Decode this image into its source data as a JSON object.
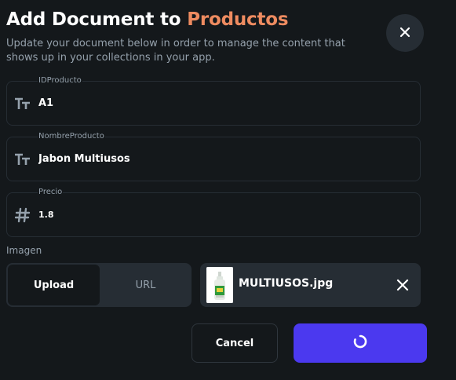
{
  "dialog": {
    "title_prefix": "Add Document to ",
    "title_collection": "Productos",
    "subtitle": "Update your document below in order to manage the content that shows up in your collections in your app.",
    "close_icon": "close-icon"
  },
  "fields": [
    {
      "label": "IDProducto",
      "value": "A1",
      "icon": "text-type-icon"
    },
    {
      "label": "NombreProducto",
      "value": "Jabon Multiusos",
      "icon": "text-type-icon"
    },
    {
      "label": "Precio",
      "value": "1.8",
      "icon": "number-hash-icon"
    }
  ],
  "image_section": {
    "label": "Imagen",
    "toggle": {
      "upload_label": "Upload",
      "url_label": "URL",
      "selected": "Upload"
    },
    "file": {
      "name": "MULTIUSOS.jpg",
      "remove_icon": "close-icon"
    }
  },
  "actions": {
    "cancel_label": "Cancel",
    "submit_icon": "loading-spinner-icon"
  },
  "colors": {
    "background": "#14181b",
    "surface": "#262d34",
    "accent": "#ee8b60",
    "primary": "#4b39ef",
    "secondary_text": "#95a1ac"
  }
}
